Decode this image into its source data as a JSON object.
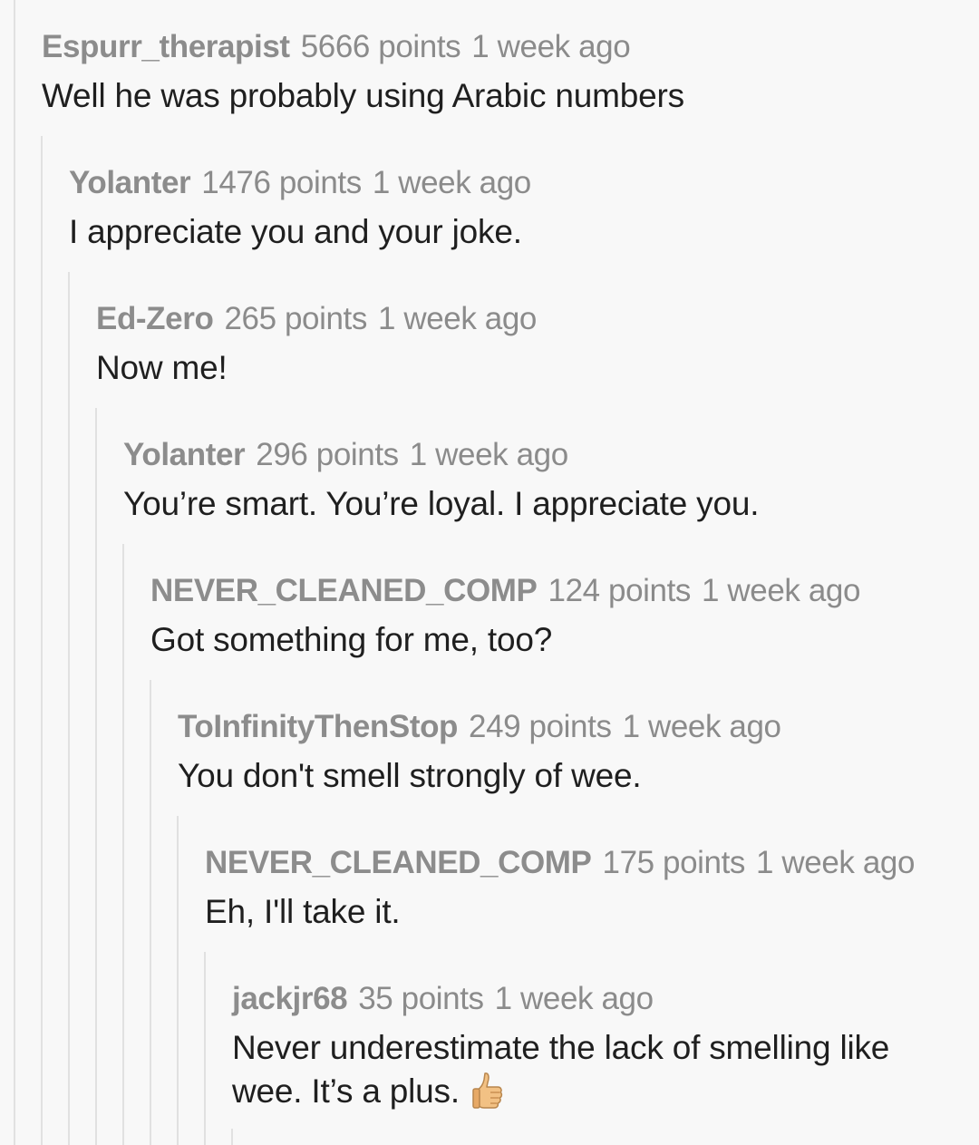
{
  "comments": [
    {
      "author": "Espurr_therapist",
      "points": "5666 points",
      "time": "1 week ago",
      "text": "Well he was probably using Arabic numbers"
    },
    {
      "author": "Yolanter",
      "points": "1476 points",
      "time": "1 week ago",
      "text": "I appreciate you and your joke."
    },
    {
      "author": "Ed-Zero",
      "points": "265 points",
      "time": "1 week ago",
      "text": "Now me!"
    },
    {
      "author": "Yolanter",
      "points": "296 points",
      "time": "1 week ago",
      "text": "You’re smart. You’re loyal. I appreciate you."
    },
    {
      "author": "NEVER_CLEANED_COMP",
      "points": "124 points",
      "time": "1 week ago",
      "text": "Got something for me, too?"
    },
    {
      "author": "ToInfinityThenStop",
      "points": "249 points",
      "time": "1 week ago",
      "text": "You don't smell strongly of wee."
    },
    {
      "author": "NEVER_CLEANED_COMP",
      "points": "175 points",
      "time": "1 week ago",
      "text": "Eh, I'll take it."
    },
    {
      "author": "jackjr68",
      "points": "35 points",
      "time": "1 week ago",
      "text": "Never underestimate the lack of smelling like wee. It’s a plus.",
      "emoji": "thumbs-up-icon"
    }
  ]
}
